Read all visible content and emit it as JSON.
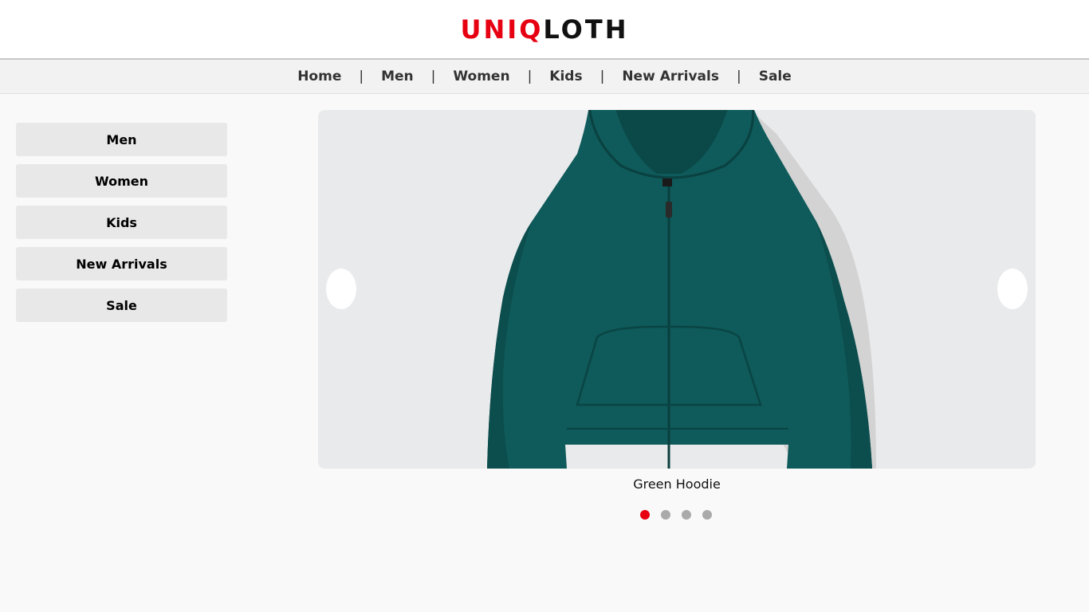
{
  "brand": {
    "logo_red": "UNIQ",
    "logo_black": "LOTH",
    "accent_color": "#e60012"
  },
  "top_nav": {
    "items": [
      {
        "label": "Home"
      },
      {
        "label": "Men"
      },
      {
        "label": "Women"
      },
      {
        "label": "Kids"
      },
      {
        "label": "New Arrivals"
      },
      {
        "label": "Sale"
      }
    ],
    "separator": "|"
  },
  "sidebar": {
    "items": [
      {
        "label": "Men"
      },
      {
        "label": "Women"
      },
      {
        "label": "Kids"
      },
      {
        "label": "New Arrivals"
      },
      {
        "label": "Sale"
      }
    ]
  },
  "carousel": {
    "current_slide": 1,
    "slide_count": 4,
    "caption": "Green Hoodie",
    "product_color": "#0f5a5a",
    "prev_icon": "chevron-left-icon",
    "next_icon": "chevron-right-icon"
  }
}
